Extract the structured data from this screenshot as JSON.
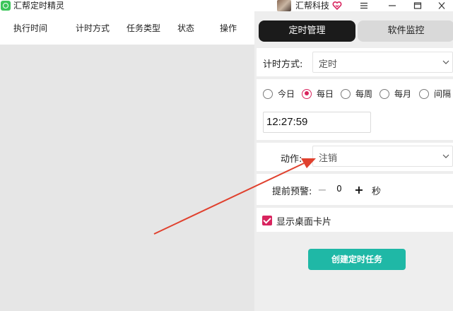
{
  "app": {
    "title": "汇帮定时精灵",
    "user_name": "汇帮科技"
  },
  "table": {
    "headers": [
      "执行时间",
      "计时方式",
      "任务类型",
      "状态",
      "操作"
    ]
  },
  "tabs": [
    {
      "label": "定时管理",
      "active": true
    },
    {
      "label": "软件监控",
      "active": false
    }
  ],
  "form": {
    "timing_mode_label": "计时方式:",
    "timing_mode_value": "定时",
    "frequency_options": [
      {
        "label": "今日",
        "checked": false
      },
      {
        "label": "每日",
        "checked": true
      },
      {
        "label": "每周",
        "checked": false
      },
      {
        "label": "每月",
        "checked": false
      },
      {
        "label": "间隔",
        "checked": false
      }
    ],
    "time_value": "12:27:59",
    "action_label": "动作:",
    "action_value": "注销",
    "advance_warning_label": "提前预警:",
    "advance_warning_value": "0",
    "advance_warning_unit": "秒",
    "show_desktop_card_label": "显示桌面卡片",
    "show_desktop_card_checked": true,
    "create_button_label": "创建定时任务"
  },
  "colors": {
    "accent": "#d8245e",
    "create_button": "#1fb8a6",
    "active_tab": "#1b1b1b",
    "annotation_arrow": "#e0412e"
  }
}
